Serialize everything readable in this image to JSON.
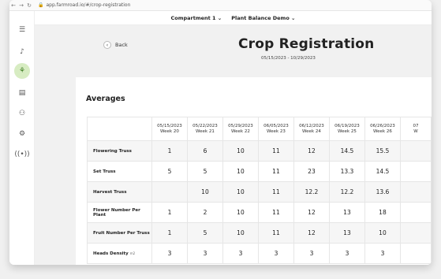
{
  "browser": {
    "url": "app.farmroad.io/#/crop-registration"
  },
  "topbar": {
    "compartment": "Compartment 1 ⌄",
    "project": "Plant Balance Demo ⌄"
  },
  "page": {
    "back_label": "Back",
    "title": "Crop Registration",
    "date_range": "05/15/2023 - 10/29/2023"
  },
  "averages": {
    "title": "Averages",
    "columns": [
      {
        "date": "05/15/2023",
        "week": "Week 20"
      },
      {
        "date": "05/22/2023",
        "week": "Week 21"
      },
      {
        "date": "05/29/2023",
        "week": "Week 22"
      },
      {
        "date": "06/05/2023",
        "week": "Week 23"
      },
      {
        "date": "06/12/2023",
        "week": "Week 24"
      },
      {
        "date": "06/19/2023",
        "week": "Week 25"
      },
      {
        "date": "06/26/2023",
        "week": "Week 26"
      },
      {
        "date": "07",
        "week": "W"
      }
    ],
    "rows": [
      {
        "label": "Flowering Truss",
        "values": [
          "1",
          "6",
          "10",
          "11",
          "12",
          "14.5",
          "15.5",
          ""
        ]
      },
      {
        "label": "Set Truss",
        "values": [
          "5",
          "5",
          "10",
          "11",
          "23",
          "13.3",
          "14.5",
          ""
        ]
      },
      {
        "label": "Harvest Truss",
        "values": [
          "",
          "10",
          "10",
          "11",
          "12.2",
          "12.2",
          "13.6",
          ""
        ]
      },
      {
        "label": "Flower Number Per Plant",
        "values": [
          "1",
          "2",
          "10",
          "11",
          "12",
          "13",
          "18",
          ""
        ]
      },
      {
        "label": "Fruit Number Per Truss",
        "values": [
          "1",
          "5",
          "10",
          "11",
          "12",
          "13",
          "10",
          ""
        ]
      },
      {
        "label": "Heads Density",
        "unit": "m2",
        "values": [
          "3",
          "3",
          "3",
          "3",
          "3",
          "3",
          "3",
          ""
        ]
      }
    ]
  }
}
